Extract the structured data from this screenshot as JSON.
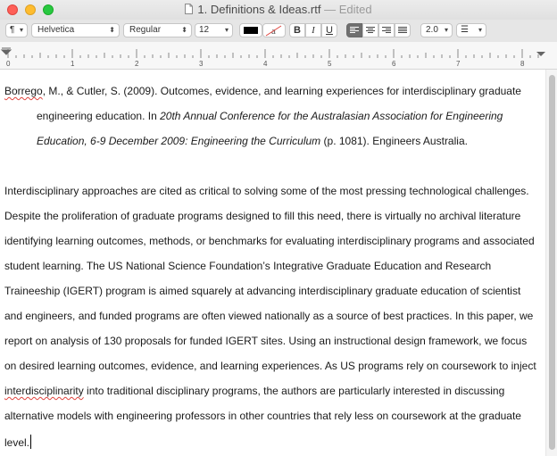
{
  "window": {
    "title": "1. Definitions & Ideas.rtf",
    "separator": "—",
    "status": "Edited"
  },
  "formatbar": {
    "paragraph_style": "¶",
    "font_family": "Helvetica",
    "font_style": "Regular",
    "font_size": "12",
    "text_color": "#000000",
    "bold_label": "B",
    "italic_label": "I",
    "underline_label": "U",
    "alignment_selected": "left",
    "line_spacing": "2.0",
    "list_label": "☰"
  },
  "ruler": {
    "numbers": [
      "0",
      "1",
      "2",
      "3",
      "4",
      "5",
      "6",
      "7",
      "8"
    ]
  },
  "document": {
    "reference": {
      "line1": "Borrego, M., & Cutler, S. (2009). Outcomes, evidence, and learning experiences for interdisciplinary graduate",
      "line2_plain": "engineering education. In ",
      "line2_italic": "20th Annual Conference for the Australasian Association for Engineering",
      "line3_italic": "Education, 6-9 December 2009: Engineering the Curriculum",
      "line3_plain": " (p. 1081). Engineers Australia."
    },
    "abstract_lines": [
      "Interdisciplinary approaches are cited as critical to solving some of the most pressing technological challenges.",
      "Despite the proliferation of graduate programs designed to fill this need, there is virtually no archival literature",
      "identifying learning outcomes, methods, or benchmarks for evaluating interdisciplinary programs and associated",
      "student learning. The US National Science Foundation’s Integrative Graduate Education and Research",
      "Traineeship (IGERT) program is aimed squarely at advancing interdisciplinary graduate education of scientist",
      "and engineers, and funded programs are often viewed nationally as a source of best practices. In this paper, we",
      "report on analysis of 130 proposals for funded IGERT sites. Using an instructional design framework, we focus",
      "on desired learning outcomes, evidence, and learning experiences. As US programs rely on coursework to inject"
    ],
    "line9_misspelled": "interdisciplinarity",
    "line9_rest": " into traditional disciplinary programs, the authors are particularly interested in discussing",
    "line10": "alternative models with engineering professors in other countries that rely less on coursework at the graduate",
    "line11": "level."
  }
}
